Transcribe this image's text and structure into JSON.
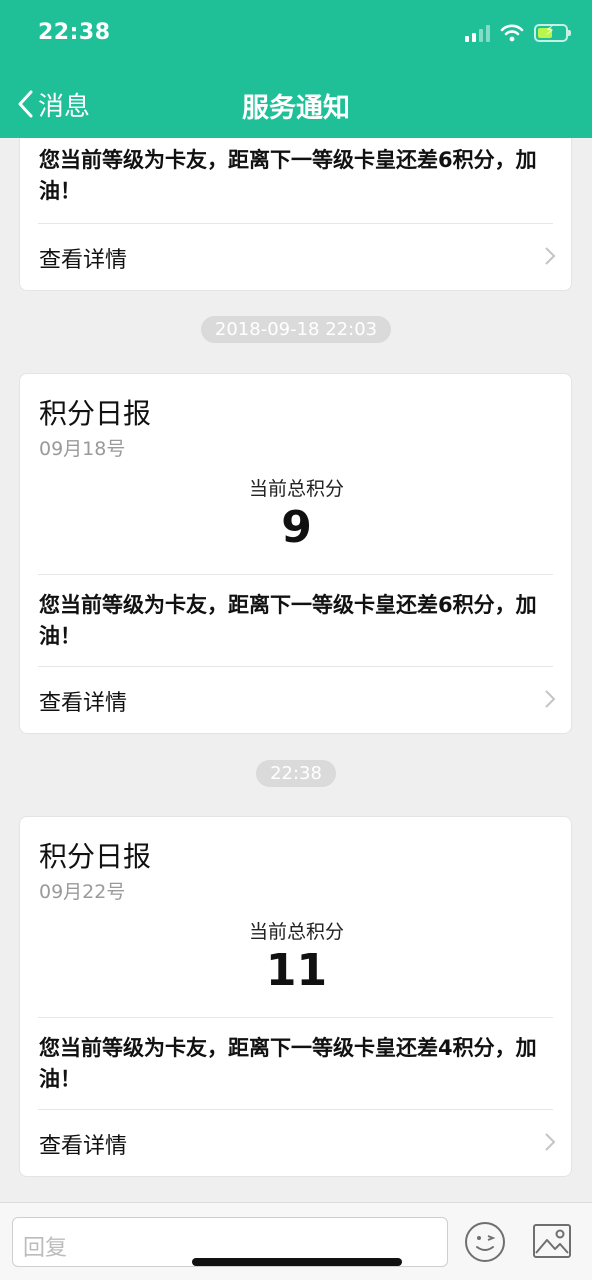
{
  "status_bar": {
    "time": "22:38"
  },
  "nav": {
    "back_label": "消息",
    "title": "服务通知"
  },
  "details_label": "查看详情",
  "partial_card": {
    "message": "您当前等级为卡友，距离下一等级卡皇还差6积分，加油！"
  },
  "timestamps": [
    "2018-09-18 22:03",
    "22:38"
  ],
  "cards": [
    {
      "title": "积分日报",
      "date": "09月18号",
      "points_label": "当前总积分",
      "points_value": "9",
      "message": "您当前等级为卡友，距离下一等级卡皇还差6积分，加油！"
    },
    {
      "title": "积分日报",
      "date": "09月22号",
      "points_label": "当前总积分",
      "points_value": "11",
      "message": "您当前等级为卡友，距离下一等级卡皇还差4积分，加油！"
    }
  ],
  "input": {
    "placeholder": "回复"
  },
  "colors": {
    "header": "#1fbf97",
    "background": "#efefef",
    "card": "#ffffff",
    "pill": "#dadada"
  }
}
